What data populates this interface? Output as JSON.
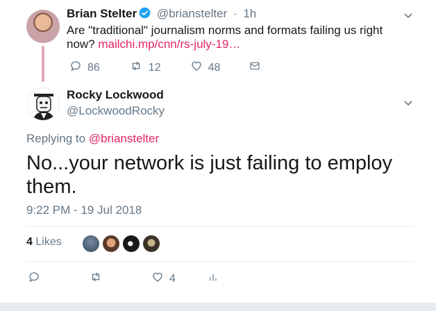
{
  "parent_tweet": {
    "name": "Brian Stelter",
    "handle": "@brianstelter",
    "separator": "·",
    "time": "1h",
    "text": "Are \"traditional\" journalism norms and formats failing us right now?",
    "link": "mailchi.mp/cnn/rs-july-19…",
    "replies": "86",
    "retweets": "12",
    "likes": "48",
    "icons": {
      "verified": "verified-badge-icon",
      "caret": "chevron-down-icon",
      "reply": "reply-icon",
      "retweet": "retweet-icon",
      "like": "heart-icon",
      "dm": "envelope-icon"
    }
  },
  "main_tweet": {
    "name": "Rocky Lockwood",
    "handle": "@LockwoodRocky",
    "replying_prefix": "Replying to",
    "replying_handle": "@brianstelter",
    "text": "No...your network is just failing to employ them.",
    "timestamp": "9:22 PM - 19 Jul 2018",
    "likes_count": "4",
    "likes_label": "Likes",
    "action_likes": "4",
    "icons": {
      "caret": "chevron-down-icon",
      "reply": "reply-icon",
      "retweet": "retweet-icon",
      "like": "heart-icon",
      "analytics": "analytics-icon"
    }
  },
  "colors": {
    "link": "#e0245e",
    "secondary_text": "#657786",
    "verified": "#1da1f2",
    "thread_line": "#e0a7b5",
    "divider": "#e6ecf0"
  }
}
